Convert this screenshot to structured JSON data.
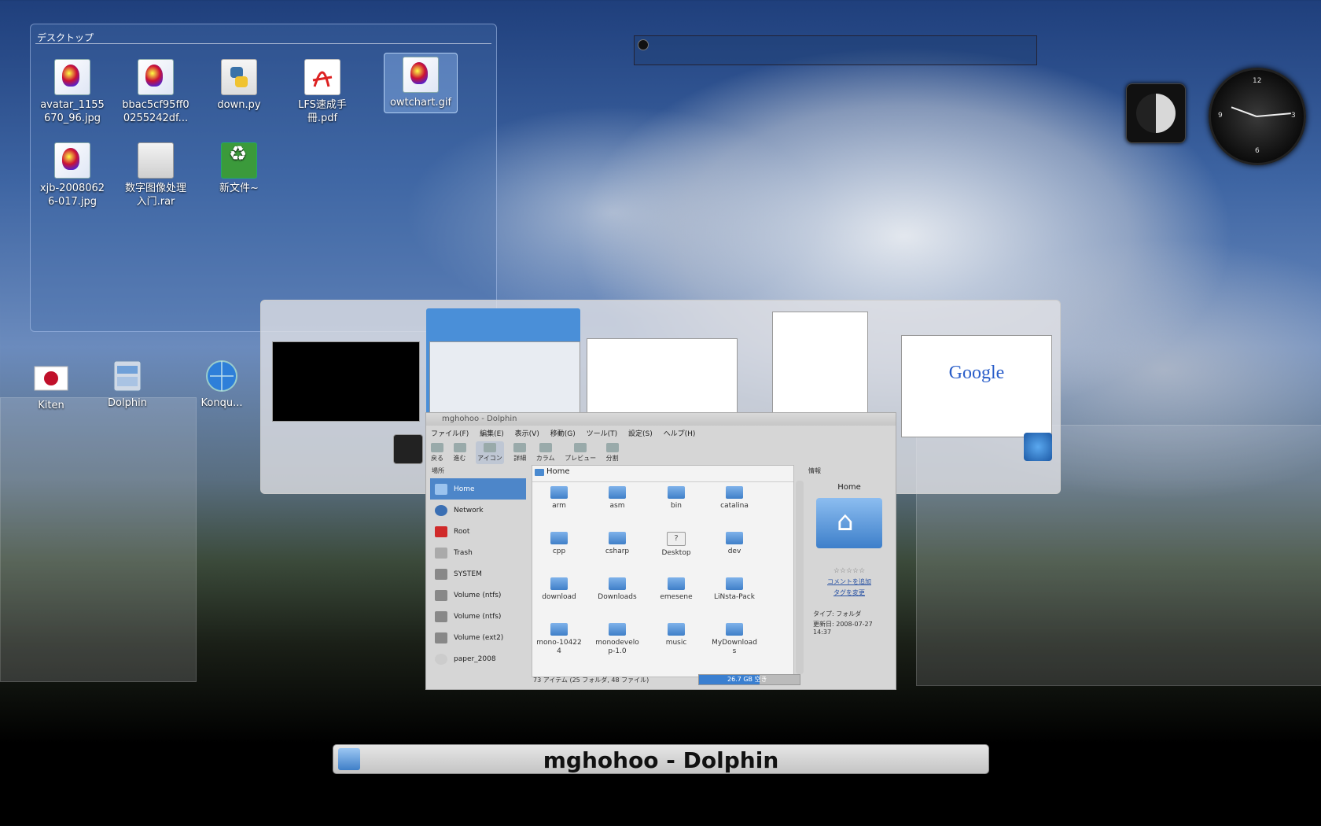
{
  "desktop": {
    "folderview_title": "デスクトップ",
    "files": [
      {
        "label": "avatar_1155\n670_96.jpg",
        "type": "image"
      },
      {
        "label": "bbac5cf95ff0\n0255242df...",
        "type": "image"
      },
      {
        "label": "down.py",
        "type": "python"
      },
      {
        "label": "LFS速成手\n冊.pdf",
        "type": "pdf"
      },
      {
        "label": "owtchart.gif",
        "type": "image"
      },
      {
        "label": "xjb-2008062\n6-017.jpg",
        "type": "image"
      },
      {
        "label": "数字图像处理\n入门.rar",
        "type": "archive"
      },
      {
        "label": "新文件~",
        "type": "recycle"
      }
    ],
    "launchers": [
      {
        "label": "Kiten",
        "icon": "japan-flag-icon"
      },
      {
        "label": "Dolphin",
        "icon": "dolphin-icon"
      },
      {
        "label": "Konqu...",
        "icon": "konqueror-globe-icon"
      }
    ]
  },
  "clock": {
    "n12": "12",
    "n3": "3",
    "n6": "6",
    "n9": "9"
  },
  "switcher": {
    "thumbnails": [
      "terminal",
      "dolphin",
      "kde-welcome",
      "chat",
      "browser-google"
    ],
    "google_text": "Google"
  },
  "dolphin": {
    "title": "mghohoo - Dolphin",
    "menu": [
      "ファイル(F)",
      "編集(E)",
      "表示(V)",
      "移動(G)",
      "ツール(T)",
      "設定(S)",
      "ヘルプ(H)"
    ],
    "toolbar": [
      "戻る",
      "進む",
      "アイコン",
      "詳細",
      "カラム",
      "プレビュー",
      "分割"
    ],
    "places_header": "場所",
    "places": [
      "Home",
      "Network",
      "Root",
      "Trash",
      "SYSTEM",
      "Volume (ntfs)",
      "Volume (ntfs)",
      "Volume (ext2)",
      "paper_2008"
    ],
    "location": "Home",
    "files": [
      "arm",
      "asm",
      "bin",
      "catalina",
      "cpp",
      "csharp",
      "Desktop",
      "dev",
      "download",
      "Downloads",
      "emesene",
      "LiNsta-Pack",
      "mono-10422\n4",
      "monodevelo\np-1.0",
      "music",
      "MyDownload\ns"
    ],
    "info_header": "情報",
    "info_title": "Home",
    "info_rating": "☆☆☆☆☆",
    "info_comment_link": "コメントを追加",
    "info_tag_link": "タグを変更",
    "info_type": "タイプ: フォルダ",
    "info_modified": "更新日: 2008-07-27\n14:37",
    "status": "73 アイテム (25 フォルダ, 48 ファイル)",
    "free_space": "26.7 GB 空き",
    "free_space_used_fraction": 0.6
  },
  "caption": "mghohoo - Dolphin",
  "colors": {
    "accent": "#4d86c9",
    "selection": "#4a8fd8"
  }
}
